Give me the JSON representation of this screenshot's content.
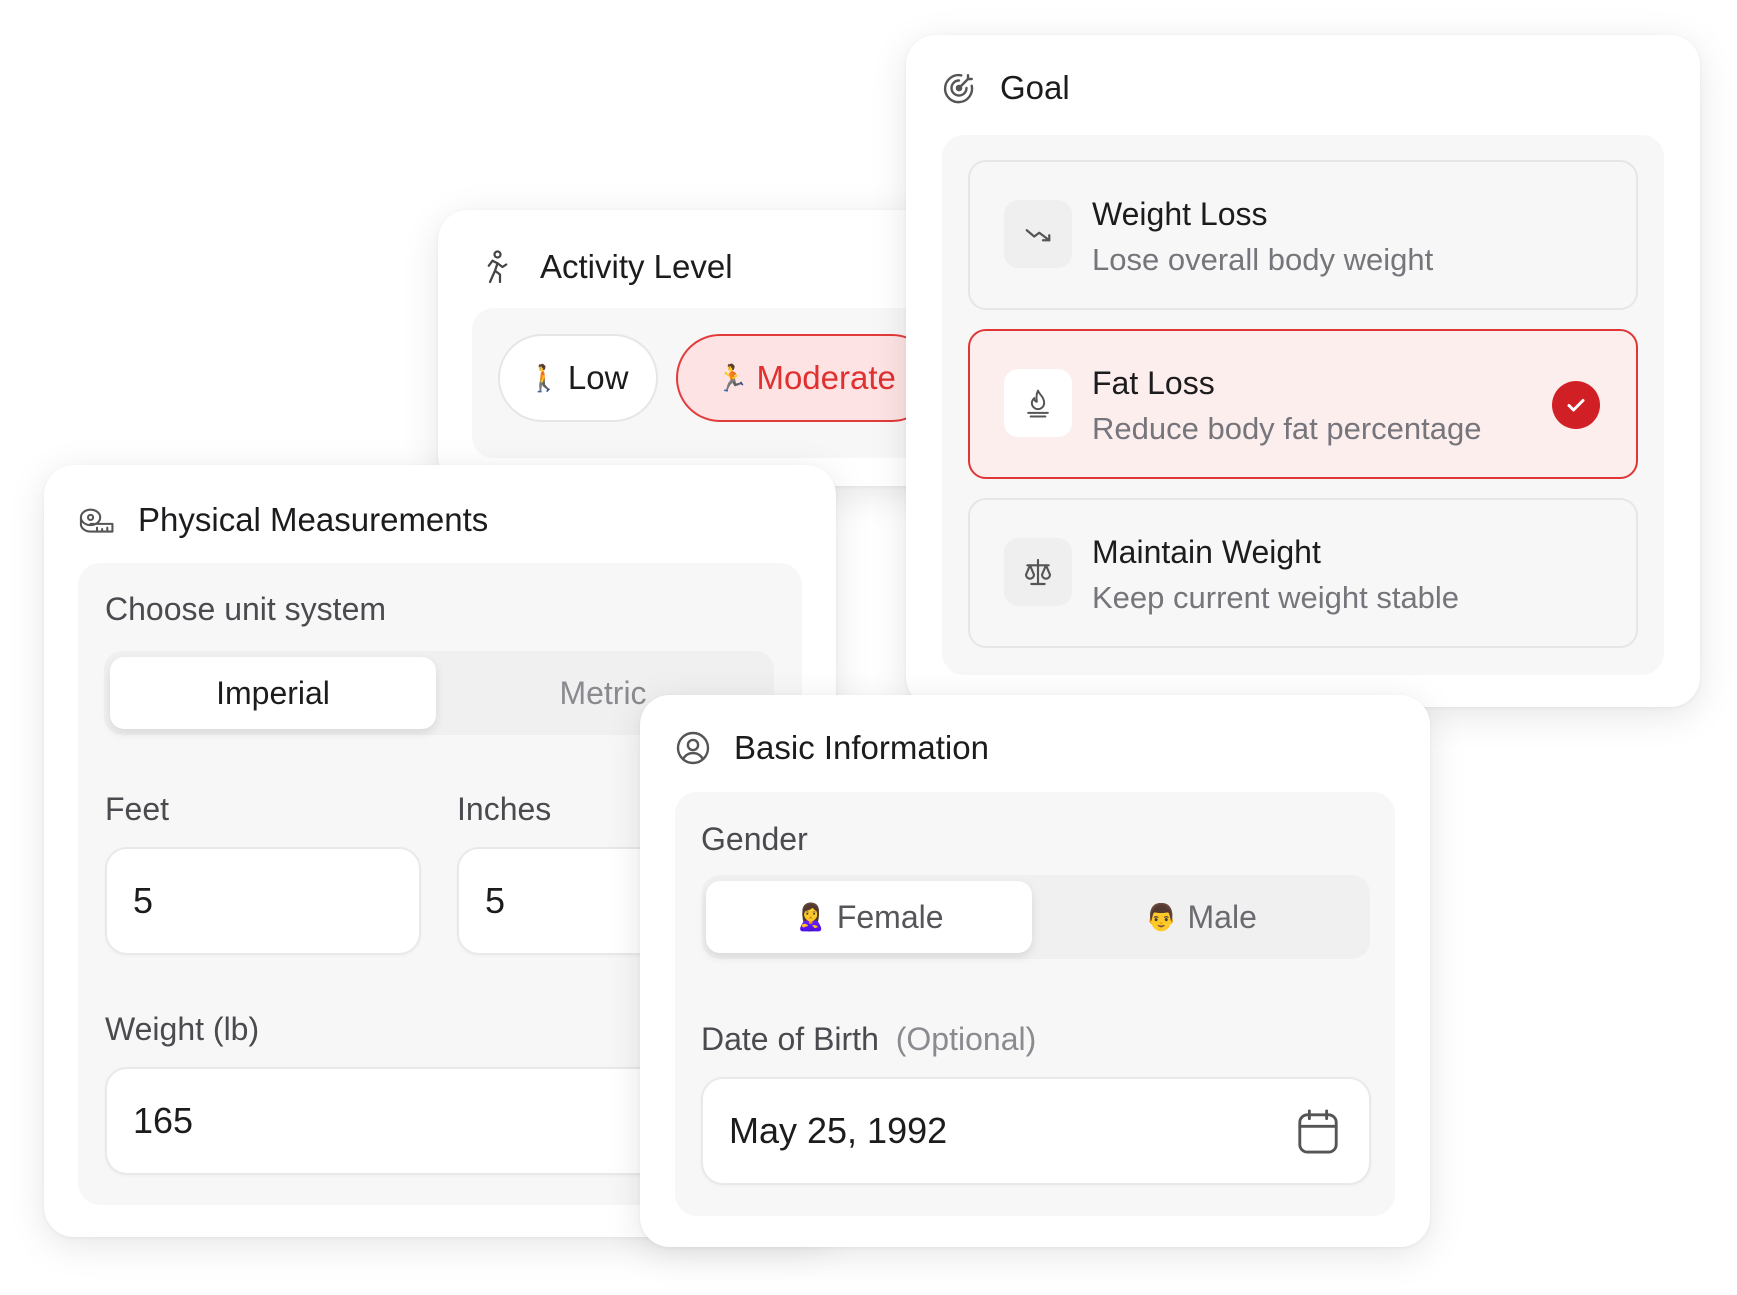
{
  "colors": {
    "accent": "#e03030",
    "accent_bg": "#fde3e3",
    "check": "#d11f26",
    "muted": "#75757b"
  },
  "activity": {
    "title": "Activity Level",
    "icon": "running-person-icon",
    "options": [
      {
        "emoji": "🚶",
        "label": "Low"
      },
      {
        "emoji": "🏃",
        "label": "Moderate"
      }
    ],
    "selected": "Moderate"
  },
  "goal": {
    "title": "Goal",
    "icon": "target-icon",
    "options": [
      {
        "title": "Weight Loss",
        "desc": "Lose overall body weight",
        "icon": "trend-down-icon"
      },
      {
        "title": "Fat Loss",
        "desc": "Reduce body fat percentage",
        "icon": "flame-icon"
      },
      {
        "title": "Maintain Weight",
        "desc": "Keep current weight stable",
        "icon": "scale-balance-icon"
      }
    ],
    "selected": "Fat Loss"
  },
  "physical": {
    "title": "Physical Measurements",
    "icon": "measuring-tape-icon",
    "unit_label": "Choose unit system",
    "units": [
      "Imperial",
      "Metric"
    ],
    "selected_unit": "Imperial",
    "feet_label": "Feet",
    "feet_value": "5",
    "inches_label": "Inches",
    "inches_value": "5",
    "weight_label": "Weight (lb)",
    "weight_value": "165"
  },
  "basic": {
    "title": "Basic Information",
    "icon": "user-circle-icon",
    "gender_label": "Gender",
    "genders": [
      {
        "emoji": "🙎‍♀️",
        "label": "Female"
      },
      {
        "emoji": "👨",
        "label": "Male"
      }
    ],
    "selected_gender": "Female",
    "dob_label": "Date of Birth",
    "dob_optional": "(Optional)",
    "dob_value": "May 25, 1992",
    "dob_icon": "calendar-icon"
  }
}
